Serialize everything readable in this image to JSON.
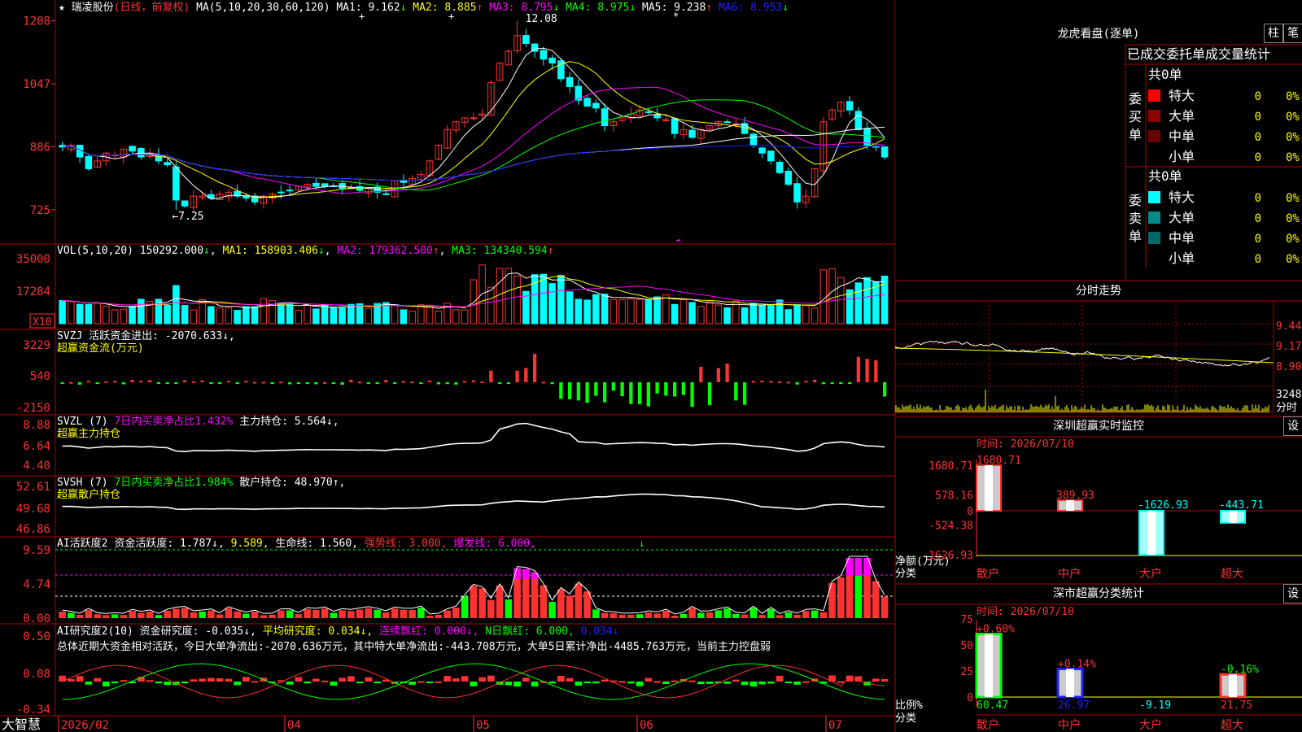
{
  "app": {
    "brand": "大智慧"
  },
  "kline_header": {
    "star": "★",
    "name": "瑞凌股份",
    "mode": "(日线，前复权)",
    "ma_label": "MA(5,10,20,30,60,120)",
    "ma": [
      {
        "label": "MA1:",
        "value": "9.162",
        "arrow": "↓",
        "color": "#ffffff"
      },
      {
        "label": "MA2:",
        "value": "8.885",
        "arrow": "↑",
        "color": "#ffff00"
      },
      {
        "label": "MA3:",
        "value": "8.795",
        "arrow": "↓",
        "color": "#ff00ff"
      },
      {
        "label": "MA4:",
        "value": "8.975",
        "arrow": "↓",
        "color": "#00ff00"
      },
      {
        "label": "MA5:",
        "value": "9.238",
        "arrow": "↑",
        "color": "#ffffff"
      },
      {
        "label": "MA6:",
        "value": "8.953",
        "arrow": "↓",
        "color": "#2020ff"
      }
    ],
    "high_note": "12.08",
    "low_note": "←7.25"
  },
  "vol_header": {
    "text": "VOL(5,10,20)",
    "value": "150292.000",
    "arrow": "↓",
    "ma1": "MA1: 158903.406",
    "ma1_arrow": "↓",
    "ma2": "MA2: 179362.500",
    "ma2_arrow": "↑",
    "ma3": "MA3: 134340.594",
    "ma3_arrow": "↑"
  },
  "svzj_header": {
    "line1": "SVZJ  活跃资金进出: -2070.633↓,",
    "line2": "超赢资金流(万元)"
  },
  "svzl_header": {
    "a": "SVZL (7) ",
    "b": "7日内买卖净占比1.432%",
    "c": " 主力持仓: 5.564↓,",
    "line2": "超赢主力持仓"
  },
  "svsh_header": {
    "a": "SVSH (7) ",
    "b": "7日内买卖净占比1.984%",
    "c": " 散户持仓: 48.970↑,",
    "line2": "超赢散户持仓"
  },
  "ai2_header": {
    "a": "AI活跃度2 ",
    "b": "资金活跃度: 1.787↓, ",
    "c": "9.589, ",
    "d": "生命线: 1.560, ",
    "e": "强势线: 3.000, ",
    "f": "爆发线: 6.000,"
  },
  "ai_research_header": {
    "a": "AI研究度2(10) ",
    "b": "资金研究度: -0.035↓, ",
    "c": "平均研究度: 0.034↓, ",
    "d": "连续飘红: 0.000↓, ",
    "e": "N日飘红: 6.000, ",
    "f": "0.034↓"
  },
  "summary_text": "总体近期大资金相对活跃，今日大单净流出:-2070.636万元，其中特大单净流出:-443.708万元，大单5日累计净出-4485.763万元，当前主力控盘弱",
  "axes": {
    "price_ticks": [
      "1208",
      "1047",
      "886",
      "725"
    ],
    "vol_ticks": [
      "35000",
      "17284"
    ],
    "vol_unit": "X10",
    "svzj_ticks": [
      "3229",
      "540",
      "-2150"
    ],
    "svzl_ticks": [
      "8.88",
      "6.64",
      "4.40"
    ],
    "svsh_ticks": [
      "52.61",
      "49.68",
      "46.86"
    ],
    "ai2_ticks": [
      "9.59",
      "4.74",
      "0.00"
    ],
    "air_ticks": [
      "0.50",
      "0.08",
      "-0.34"
    ],
    "dates": [
      "2026/02",
      "04",
      "05",
      "06",
      "07"
    ]
  },
  "dragon_tiger": {
    "title": "龙虎看盘(逐单)",
    "btn_zhu": "柱",
    "btn_bi": "笔",
    "table_title": "已成交委托单成交量统计",
    "buy_label": "委买单",
    "sell_label": "委卖单",
    "buy_total": "共0单",
    "sell_total": "共0单",
    "rows": [
      "特大",
      "大单",
      "中单",
      "小单"
    ],
    "counts": [
      "0",
      "0",
      "0",
      "0"
    ],
    "pcts": [
      "0%",
      "0%",
      "0%",
      "0%"
    ],
    "buy_colors": [
      "#ff0000",
      "#8a0000",
      "#6a0000",
      ""
    ],
    "sell_colors": [
      "#00ffff",
      "#008a8a",
      "#006a6a",
      ""
    ]
  },
  "intraday": {
    "title": "分时走势",
    "ticks": [
      "9.44",
      "9.17",
      "8.90"
    ],
    "vol_tick": "3248",
    "vol_unit": "分时"
  },
  "sz_monitor": {
    "title": "深圳超赢实时监控",
    "btn": "设",
    "time": "时间: 2026/07/10",
    "ticks": [
      "1680.71",
      "578.16",
      "0",
      "-524.38",
      "-1626.93"
    ],
    "values": [
      1680.71,
      389.93,
      -1626.93,
      -443.71
    ],
    "value_labels": [
      "1680.71",
      "389.93",
      "-1626.93",
      "-443.71"
    ],
    "cats": [
      "散户",
      "中户",
      "大户",
      "超大"
    ],
    "unit": "净额(万元)",
    "unit2": "分类"
  },
  "sz_class": {
    "title": "深市超赢分类统计",
    "btn": "设",
    "time": "时间: 2026/07/10",
    "ticks": [
      "75",
      "50",
      "25",
      "0"
    ],
    "values": [
      60.47,
      26.97,
      -9.19,
      21.75
    ],
    "bottom_labels": [
      "60.47",
      "26.97",
      "-9.19",
      "21.75"
    ],
    "top_labels": [
      "+0.60%",
      "+0.14%",
      "",
      "-0.16%"
    ],
    "cats": [
      "散户",
      "中户",
      "大户",
      "超大"
    ],
    "unit": "比例%",
    "unit2": "分类"
  },
  "colors": {
    "up": "#ff3232",
    "down": "#00ffff",
    "grid": "#b00000",
    "axis_text": "#ff3232",
    "ma1": "#ffffff",
    "ma2": "#ffff00",
    "ma3": "#ff00ff",
    "ma4": "#00ff00",
    "ma6": "#2020ff"
  },
  "chart_data": {
    "type": "line",
    "note": "daily candlestick stock chart 瑞凌股份",
    "x": [
      "2026/02",
      "04",
      "05",
      "06",
      "07"
    ],
    "close": [
      8.85,
      8.9,
      8.6,
      8.3,
      8.5,
      8.7,
      8.65,
      8.8,
      8.75,
      8.6,
      8.7,
      8.5,
      8.4,
      7.5,
      7.35,
      7.6,
      7.6,
      7.55,
      7.65,
      7.7,
      7.6,
      7.55,
      7.45,
      7.6,
      7.65,
      7.7,
      7.75,
      7.85,
      7.9,
      7.85,
      7.85,
      7.85,
      7.8,
      7.8,
      7.75,
      7.8,
      7.7,
      7.65,
      8.0,
      7.95,
      8.05,
      8.15,
      8.5,
      8.9,
      9.3,
      9.5,
      9.6,
      9.6,
      9.7,
      10.5,
      11.0,
      11.3,
      11.7,
      11.5,
      11.3,
      11.1,
      11.0,
      10.6,
      10.4,
      10.05,
      9.9,
      9.85,
      9.4,
      9.5,
      9.6,
      9.7,
      9.8,
      9.75,
      9.6,
      9.55,
      9.2,
      9.3,
      9.1,
      9.3,
      9.4,
      9.5,
      9.5,
      9.45,
      9.2,
      8.9,
      8.7,
      8.5,
      8.2,
      7.9,
      7.45,
      7.6,
      8.3,
      9.5,
      9.8,
      10.0,
      9.8,
      9.3,
      8.9,
      8.85,
      8.6
    ],
    "high_mark": 12.08,
    "low_mark": 7.25,
    "ma_series": [
      {
        "name": "MA1"
      },
      {
        "name": "MA2"
      },
      {
        "name": "MA3"
      },
      {
        "name": "MA4"
      },
      {
        "name": "MA5"
      },
      {
        "name": "MA6"
      }
    ]
  }
}
